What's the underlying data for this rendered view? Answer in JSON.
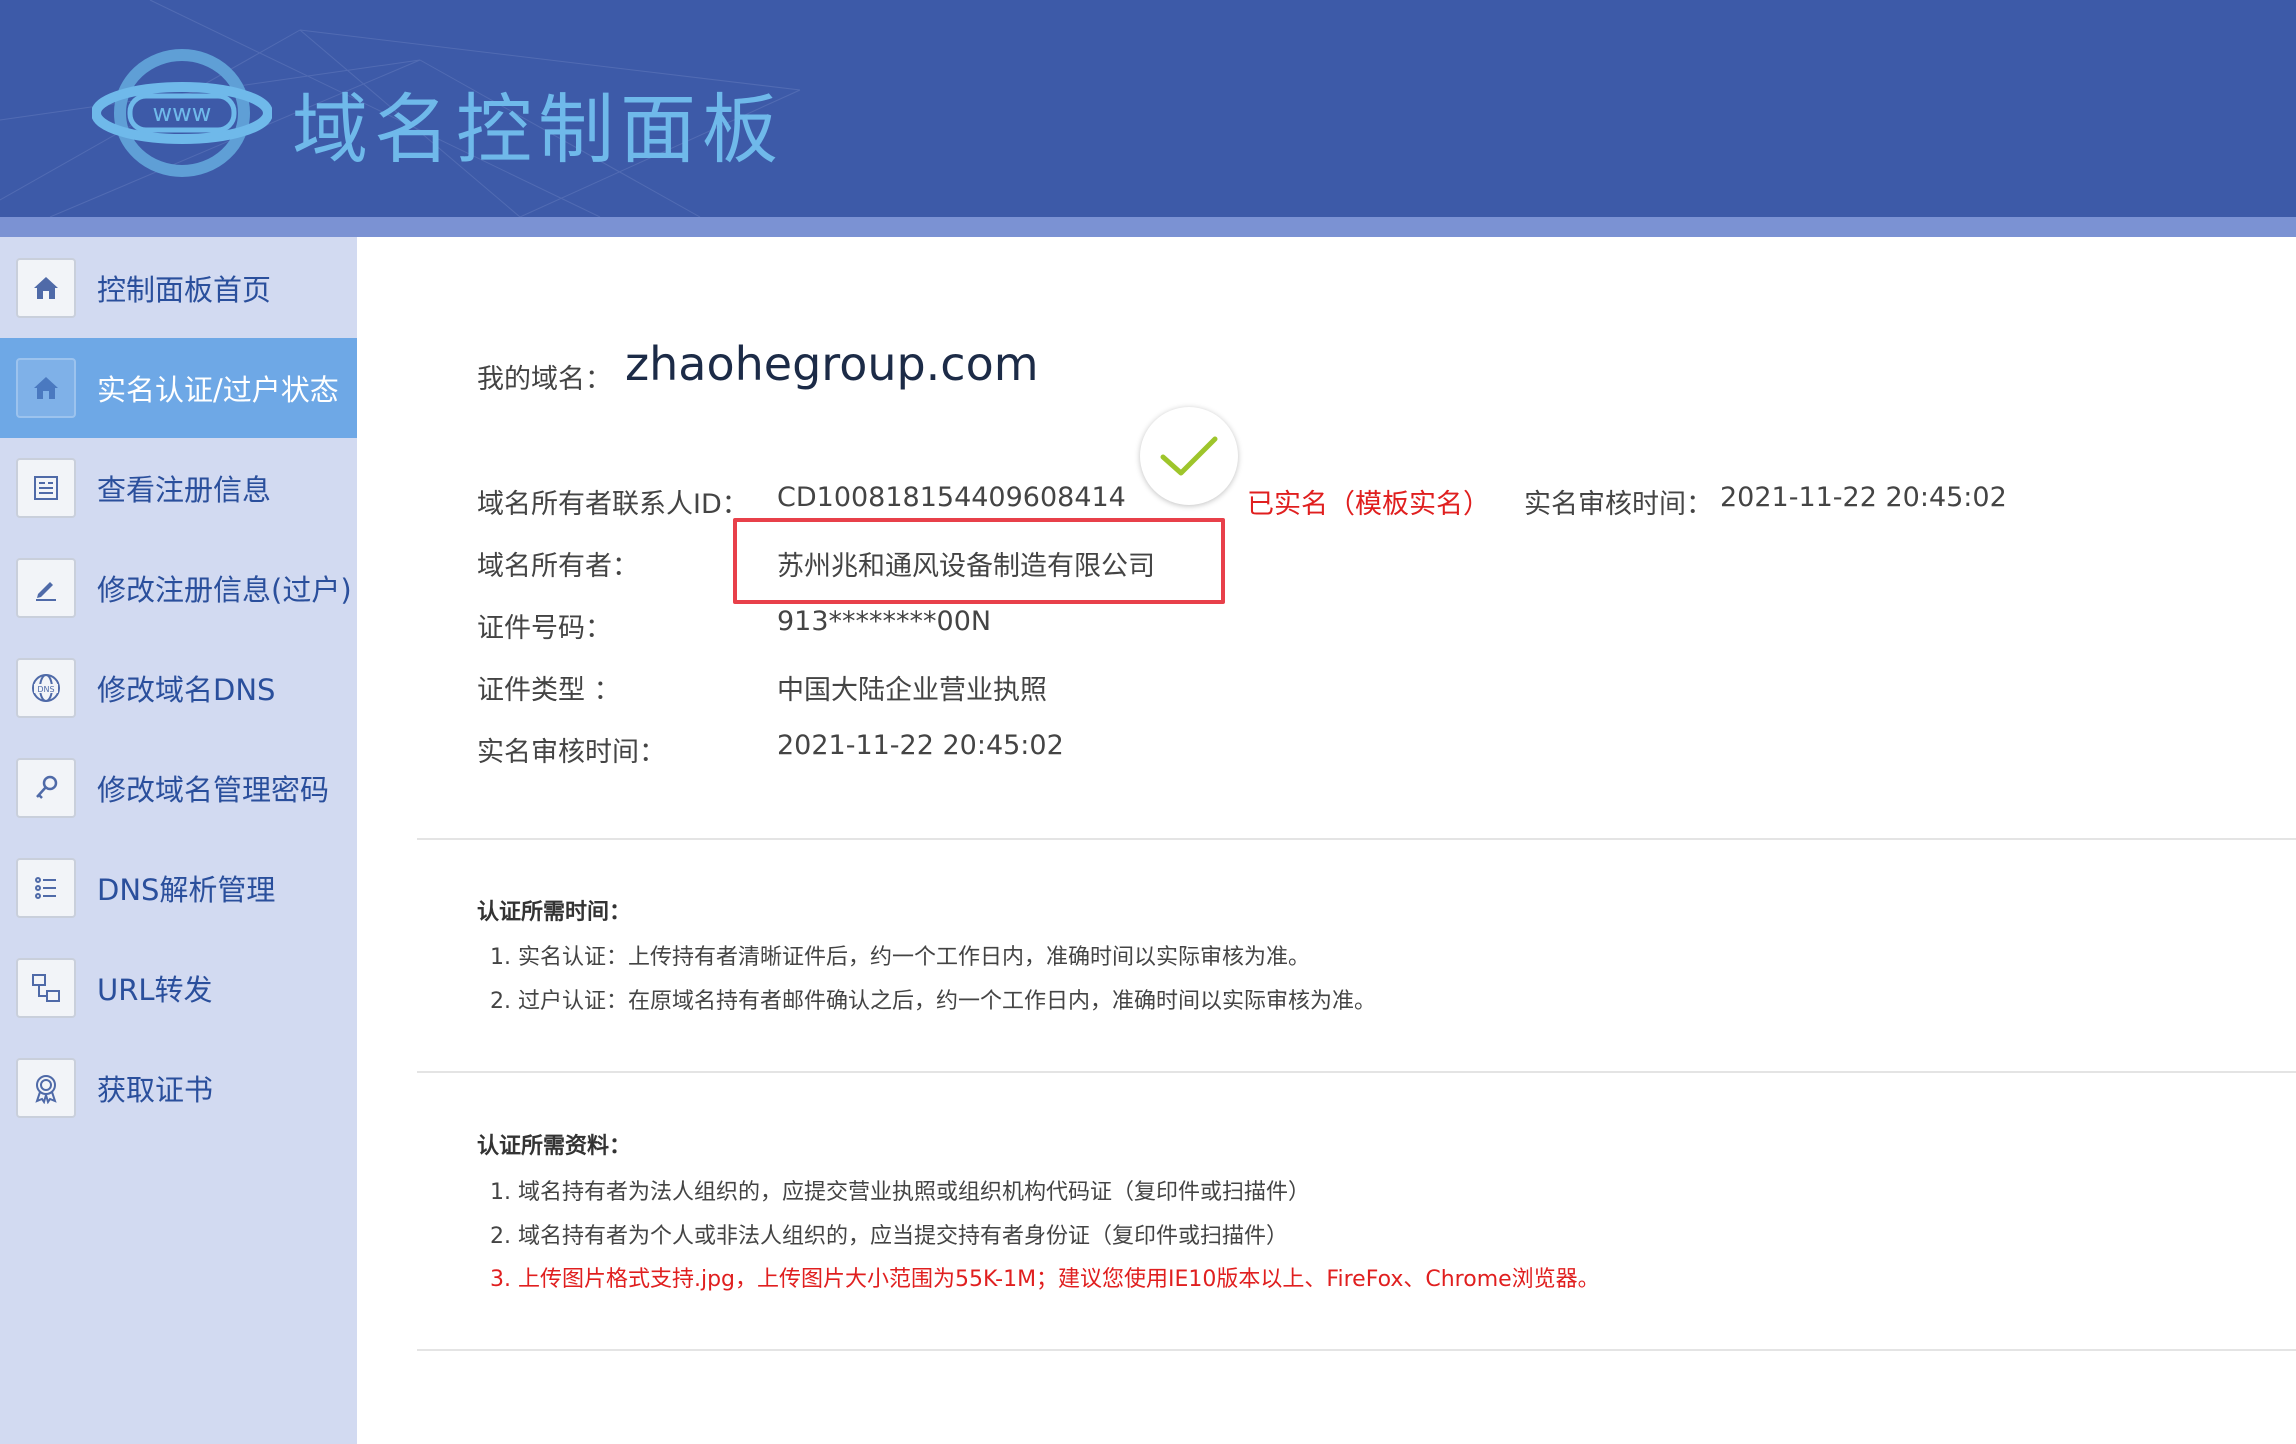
{
  "header": {
    "logo_icon": "www-globe-logo",
    "title": "域名控制面板"
  },
  "sidebar": {
    "items": [
      {
        "label": "控制面板首页",
        "icon": "home-icon"
      },
      {
        "label": "实名认证/过户状态",
        "icon": "home-icon",
        "active": true
      },
      {
        "label": "查看注册信息",
        "icon": "document-list-icon"
      },
      {
        "label": "修改注册信息(过户)",
        "icon": "edit-pencil-icon"
      },
      {
        "label": "修改域名DNS",
        "icon": "dns-globe-icon"
      },
      {
        "label": "修改域名管理密码",
        "icon": "key-icon"
      },
      {
        "label": "DNS解析管理",
        "icon": "list-icon"
      },
      {
        "label": "URL转发",
        "icon": "forward-icon"
      },
      {
        "label": "获取证书",
        "icon": "certificate-icon"
      }
    ]
  },
  "domain": {
    "label": "我的域名：",
    "value": "zhaohegroup.com"
  },
  "info": {
    "contact_id_label": "域名所有者联系人ID：",
    "contact_id_value": "CD100818154409608414",
    "status": "已实名（模板实名）",
    "audit_label": "实名审核时间：",
    "audit_value": "2021-11-22 20:45:02",
    "owner_label": "域名所有者：",
    "owner_value": "苏州兆和通风设备制造有限公司",
    "cert_no_label": "证件号码：",
    "cert_no_value": "913********00N",
    "cert_type_label": "证件类型 ：",
    "cert_type_value": "中国大陆企业营业执照",
    "verify_time_label": "实名审核时间：",
    "verify_time_value": "2021-11-22 20:45:02"
  },
  "time_section": {
    "title": "认证所需时间：",
    "items": [
      "1. 实名认证：上传持有者清晰证件后，约一个工作日内，准确时间以实际审核为准。",
      "2. 过户认证：在原域名持有者邮件确认之后，约一个工作日内，准确时间以实际审核为准。"
    ]
  },
  "material_section": {
    "title": "认证所需资料：",
    "items": [
      "1. 域名持有者为法人组织的，应提交营业执照或组织机构代码证（复印件或扫描件）",
      "2. 域名持有者为个人或非法人组织的，应当提交持有者身份证（复印件或扫描件）",
      "3. 上传图片格式支持.jpg，上传图片大小范围为55K-1M；建议您使用IE10版本以上、FireFox、Chrome浏览器。"
    ]
  },
  "colors": {
    "header_bg": "#3d5aa8",
    "sidebar_bg": "#d2daf1",
    "active_bg": "#6ea8e6",
    "status_red": "#e01f1f",
    "check_green": "#9ec52b"
  }
}
